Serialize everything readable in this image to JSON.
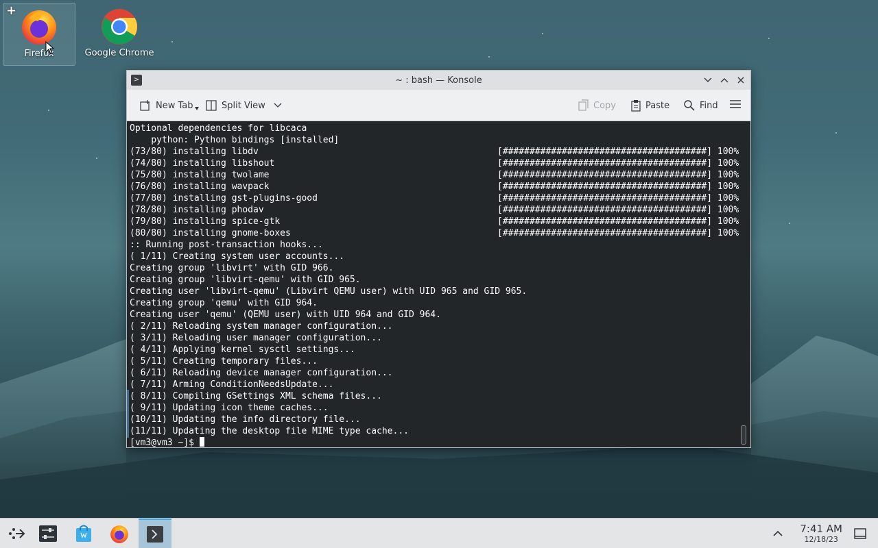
{
  "desktop": {
    "icons": [
      {
        "label": "Firefox"
      },
      {
        "label": "Google Chrome"
      }
    ],
    "selected_badge": "+"
  },
  "window": {
    "title": "~ : bash — Konsole",
    "app_icon": ">"
  },
  "toolbar": {
    "new_tab": "New Tab",
    "split_view": "Split View",
    "copy": "Copy",
    "paste": "Paste",
    "find": "Find"
  },
  "terminal": {
    "lines": [
      {
        "text": "Optional dependencies for libcaca",
        "bar": ""
      },
      {
        "text": "    python: Python bindings [installed]",
        "bar": ""
      },
      {
        "text": "(73/80) installing libdv",
        "bar": "[######################################] 100%"
      },
      {
        "text": "(74/80) installing libshout",
        "bar": "[######################################] 100%"
      },
      {
        "text": "(75/80) installing twolame",
        "bar": "[######################################] 100%"
      },
      {
        "text": "(76/80) installing wavpack",
        "bar": "[######################################] 100%"
      },
      {
        "text": "(77/80) installing gst-plugins-good",
        "bar": "[######################################] 100%"
      },
      {
        "text": "(78/80) installing phodav",
        "bar": "[######################################] 100%"
      },
      {
        "text": "(79/80) installing spice-gtk",
        "bar": "[######################################] 100%"
      },
      {
        "text": "(80/80) installing gnome-boxes",
        "bar": "[######################################] 100%"
      },
      {
        "text": ":: Running post-transaction hooks...",
        "bar": ""
      },
      {
        "text": "( 1/11) Creating system user accounts...",
        "bar": ""
      },
      {
        "text": "Creating group 'libvirt' with GID 966.",
        "bar": ""
      },
      {
        "text": "Creating group 'libvirt-qemu' with GID 965.",
        "bar": ""
      },
      {
        "text": "Creating user 'libvirt-qemu' (Libvirt QEMU user) with UID 965 and GID 965.",
        "bar": ""
      },
      {
        "text": "Creating group 'qemu' with GID 964.",
        "bar": ""
      },
      {
        "text": "Creating user 'qemu' (QEMU user) with UID 964 and GID 964.",
        "bar": ""
      },
      {
        "text": "( 2/11) Reloading system manager configuration...",
        "bar": ""
      },
      {
        "text": "( 3/11) Reloading user manager configuration...",
        "bar": ""
      },
      {
        "text": "( 4/11) Applying kernel sysctl settings...",
        "bar": ""
      },
      {
        "text": "( 5/11) Creating temporary files...",
        "bar": ""
      },
      {
        "text": "( 6/11) Reloading device manager configuration...",
        "bar": ""
      },
      {
        "text": "( 7/11) Arming ConditionNeedsUpdate...",
        "bar": ""
      },
      {
        "text": "( 8/11) Compiling GSettings XML schema files...",
        "bar": ""
      },
      {
        "text": "( 9/11) Updating icon theme caches...",
        "bar": ""
      },
      {
        "text": "(10/11) Updating the info directory file...",
        "bar": ""
      },
      {
        "text": "(11/11) Updating the desktop file MIME type cache...",
        "bar": ""
      }
    ],
    "prompt": "[vm3@vm3 ~]$ "
  },
  "taskbar": {
    "time": "7:41 AM",
    "date": "12/18/23"
  },
  "colors": {
    "accent": "#3daee9",
    "terminal_bg": "#232629",
    "terminal_fg": "#fcfcfc"
  }
}
